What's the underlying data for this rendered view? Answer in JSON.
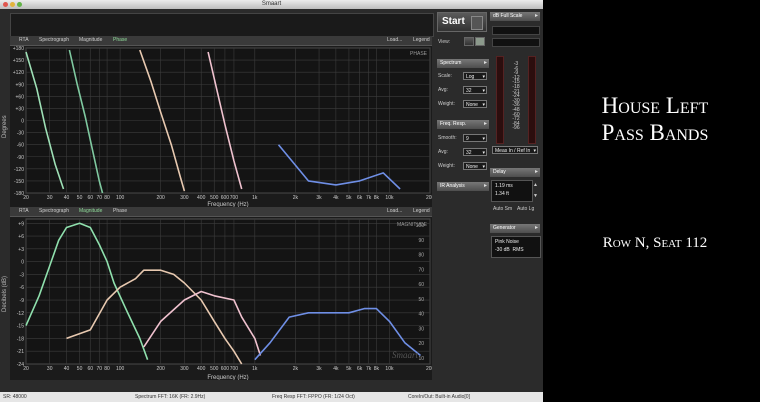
{
  "window": {
    "title": "Smaart"
  },
  "top_tabs": {
    "rta": "RTA",
    "spectrograph": "Spectrograph",
    "magnitude": "Magnitude",
    "phase": "Phase",
    "load": "Load...",
    "legend": "Legend"
  },
  "phase_plot": {
    "corner_label": "PHASE",
    "ylabel": "Degrees",
    "xlabel": "Frequency (Hz)",
    "y_ticks": [
      "+180",
      "+150",
      "+120",
      "+90",
      "+60",
      "+30",
      "0",
      "-30",
      "-60",
      "-90",
      "-120",
      "-150",
      "-180"
    ],
    "x_ticks": [
      "20",
      "30",
      "40",
      "50",
      "60",
      "70",
      "80",
      "100",
      "200",
      "300",
      "400",
      "500",
      "600",
      "700",
      "1k",
      "2k",
      "3k",
      "4k",
      "5k",
      "6k",
      "7k",
      "8k",
      "10k",
      "20k"
    ]
  },
  "bottom_tabs": {
    "rta": "RTA",
    "spectrograph": "Spectrograph",
    "magnitude": "Magnitude",
    "phase": "Phase",
    "load": "Load...",
    "legend": "Legend"
  },
  "magnitude_plot": {
    "corner_label": "MAGNITUDE",
    "ylabel": "Decibels (dB)",
    "xlabel": "Frequency (Hz)",
    "y_ticks": [
      "+9",
      "+6",
      "+3",
      "0",
      "-3",
      "-6",
      "-9",
      "-12",
      "-15",
      "-18",
      "-21",
      "-24"
    ],
    "y2_ticks": [
      "100",
      "90",
      "80",
      "70",
      "60",
      "50",
      "40",
      "30",
      "20",
      "10"
    ],
    "x_ticks": [
      "20",
      "30",
      "40",
      "50",
      "60",
      "70",
      "80",
      "100",
      "200",
      "300",
      "400",
      "500",
      "600",
      "700",
      "1k",
      "2k",
      "3k",
      "4k",
      "5k",
      "6k",
      "7k",
      "8k",
      "10k",
      "20k"
    ],
    "watermark": "Smaart"
  },
  "chart_data": [
    {
      "type": "line",
      "title": "PHASE",
      "xlabel": "Frequency (Hz)",
      "ylabel": "Degrees",
      "xscale": "log",
      "xlim": [
        20,
        20000
      ],
      "ylim": [
        -180,
        180
      ],
      "series": [
        {
          "color": "#9ee0b6",
          "points": [
            [
              20,
              170
            ],
            [
              24,
              80
            ],
            [
              28,
              -20
            ],
            [
              33,
              -110
            ],
            [
              38,
              -170
            ]
          ]
        },
        {
          "color": "#7fc9a0",
          "points": [
            [
              42,
              175
            ],
            [
              48,
              90
            ],
            [
              55,
              10
            ],
            [
              62,
              -70
            ],
            [
              70,
              -150
            ],
            [
              74,
              -180
            ]
          ]
        },
        {
          "color": "#e8c9b0",
          "points": [
            [
              140,
              175
            ],
            [
              170,
              95
            ],
            [
              200,
              20
            ],
            [
              240,
              -60
            ],
            [
              280,
              -140
            ],
            [
              300,
              -175
            ]
          ]
        },
        {
          "color": "#f0c2cf",
          "points": [
            [
              450,
              170
            ],
            [
              520,
              80
            ],
            [
              600,
              -10
            ],
            [
              700,
              -100
            ],
            [
              800,
              -170
            ]
          ]
        },
        {
          "color": "#6f8fe6",
          "points": [
            [
              1500,
              -60
            ],
            [
              2500,
              -150
            ],
            [
              4000,
              -160
            ],
            [
              6000,
              -150
            ],
            [
              9000,
              -130
            ],
            [
              12000,
              -170
            ]
          ]
        }
      ]
    },
    {
      "type": "line",
      "title": "MAGNITUDE",
      "xlabel": "Frequency (Hz)",
      "ylabel": "Decibels (dB)",
      "xscale": "log",
      "xlim": [
        20,
        20000
      ],
      "ylim": [
        -24,
        10
      ],
      "series": [
        {
          "color": "#8fe0ad",
          "points": [
            [
              20,
              -15
            ],
            [
              25,
              -8
            ],
            [
              30,
              -1
            ],
            [
              35,
              5
            ],
            [
              40,
              8
            ],
            [
              50,
              9
            ],
            [
              60,
              8
            ],
            [
              70,
              4
            ],
            [
              80,
              0
            ],
            [
              90,
              -5
            ],
            [
              110,
              -11
            ],
            [
              140,
              -18
            ],
            [
              160,
              -23
            ]
          ]
        },
        {
          "color": "#e8c9b0",
          "points": [
            [
              40,
              -18
            ],
            [
              60,
              -16
            ],
            [
              80,
              -9
            ],
            [
              100,
              -6
            ],
            [
              130,
              -4
            ],
            [
              150,
              -2
            ],
            [
              200,
              -2
            ],
            [
              250,
              -3
            ],
            [
              300,
              -5
            ],
            [
              400,
              -9
            ],
            [
              500,
              -14
            ],
            [
              600,
              -18
            ],
            [
              700,
              -21
            ],
            [
              800,
              -24
            ]
          ]
        },
        {
          "color": "#f0c2cf",
          "points": [
            [
              150,
              -20
            ],
            [
              200,
              -14
            ],
            [
              300,
              -9
            ],
            [
              400,
              -7
            ],
            [
              500,
              -8
            ],
            [
              700,
              -9
            ],
            [
              800,
              -13
            ],
            [
              1000,
              -18
            ],
            [
              1100,
              -22
            ]
          ]
        },
        {
          "color": "#6f8fe6",
          "points": [
            [
              1000,
              -23
            ],
            [
              1300,
              -19
            ],
            [
              1800,
              -13
            ],
            [
              2500,
              -12
            ],
            [
              3500,
              -12
            ],
            [
              5000,
              -12
            ],
            [
              6500,
              -11
            ],
            [
              8000,
              -11
            ],
            [
              10000,
              -14
            ],
            [
              13000,
              -19
            ],
            [
              17000,
              -22
            ]
          ]
        }
      ]
    }
  ],
  "controls": {
    "start_label": "Start",
    "view_label": "View:",
    "spectrum_header": "Spectrum",
    "scale_label": "Scale:",
    "scale_value": "Log",
    "avg_label": "Avg:",
    "avg_value": "32",
    "weight_label": "Weight:",
    "weight_value": "None",
    "freq_resp_header": "Freq. Resp.",
    "smooth_label": "Smooth:",
    "smooth_value": "9",
    "avg2_label": "Avg:",
    "avg2_value": "32",
    "weight2_label": "Weight:",
    "weight2_value": "None",
    "ir_header": "IR Analysis"
  },
  "meter": {
    "full_scale_label": "dB Full Scale",
    "scale": [
      "-3",
      "-6",
      "-9",
      "-12",
      "-15",
      "-18",
      "-21",
      "-24",
      "-30",
      "-36",
      "-48",
      "-60",
      "-72",
      "-84",
      "-96"
    ],
    "meas_label": "Meas In / Ref In"
  },
  "delay": {
    "header": "Delay",
    "ms": "1.19 ms",
    "ft": "1.34 ft",
    "auto_sm": "Auto Sm",
    "auto_lg": "Auto Lg"
  },
  "generator": {
    "header": "Generator",
    "signal": "Pink Noise",
    "level": "-30 dB",
    "rms": "RMS"
  },
  "status": {
    "sr": "SR: 48000",
    "spectrum_fft": "Spectrum FFT: 16K (FR: 2.9Hz)",
    "freq_fft": "Freq Resp FFT: FPPO (FR: 1/24 Oct)",
    "io": "CoreIn/Out: Built-in Audio[0]"
  },
  "caption": {
    "line1": "House Left",
    "line2": "Pass Bands",
    "line3": "Row N, Seat 112"
  }
}
